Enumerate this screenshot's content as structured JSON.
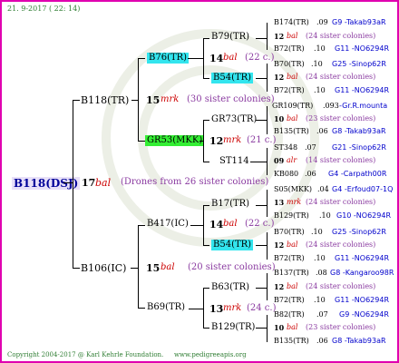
{
  "header": {
    "date": "21. 9-2017 ( 22: 14)"
  },
  "footer": {
    "copyright": "Copyright 2004-2017 @ Karl Kehrle Foundation.",
    "site": "www.pedigreeapis.org"
  },
  "root": {
    "id": "B118(DSJ)",
    "num": "17",
    "bal": "bal",
    "drones": "(Drones from 26 sister colonies)"
  },
  "father": {
    "id": "B118(TR)",
    "num": "15",
    "mrk": "mrk",
    "sis": "(30 sister colonies)",
    "a": {
      "id": "B76(TR)",
      "num": "14",
      "bal": "bal",
      "sis": "(22 c.)",
      "a": {
        "id": "B79(TR)"
      },
      "b": {
        "id": "B54(TR)"
      }
    },
    "b": {
      "id": "GR53(MKK)",
      "num": "12",
      "mrk": "mrk",
      "sis": "(21 c.)",
      "a": {
        "id": "GR73(TR)"
      },
      "b": {
        "id": "ST114"
      }
    }
  },
  "mother": {
    "id": "B106(IC)",
    "num": "15",
    "bal": "bal",
    "sis": "(20 sister colonies)",
    "a": {
      "id": "B417(IC)",
      "num": "14",
      "bal": "bal",
      "sis": "(22 c.)",
      "a": {
        "id": "B17(TR)"
      },
      "b": {
        "id": "B54(TR)"
      }
    },
    "b": {
      "id": "B69(TR)",
      "num": "13",
      "mrk": "mrk",
      "sis": "(24 c.)",
      "a": {
        "id": "B63(TR)"
      },
      "b": {
        "id": "B129(TR)"
      }
    }
  },
  "right": [
    {
      "id": "B174(TR)",
      "yr": ".09",
      "code": "G9 -Takab93aR"
    },
    {
      "num": "12",
      "race": "bal",
      "sis": "(24 sister colonies)"
    },
    {
      "id": "B72(TR)",
      "yr": ".10",
      "code": "G11 -NO6294R"
    },
    {
      "id": "B70(TR)",
      "yr": ".10",
      "code": "G25 -Sinop62R"
    },
    {
      "num": "12",
      "race": "bal",
      "sis": "(24 sister colonies)"
    },
    {
      "id": "B72(TR)",
      "yr": ".10",
      "code": "G11 -NO6294R"
    },
    {
      "id": "GR109(TR)",
      "yr": ".093",
      "code": "-Gr.R.mounta"
    },
    {
      "num": "10",
      "race": "bal",
      "sis": "(23 sister colonies)"
    },
    {
      "id": "B135(TR)",
      "yr": ".06",
      "code": "G8 -Takab93aR"
    },
    {
      "id": "ST348",
      "yr": ".07",
      "code": "G21 -Sinop62R"
    },
    {
      "num": "09",
      "race": "alr",
      "sis": "(14 sister colonies)"
    },
    {
      "id": "KB080",
      "yr": ".06",
      "code": "G4 -Carpath00R"
    },
    {
      "id": "S05(MKK)",
      "yr": ".04",
      "code": "G4 -Erfoud07-1Q"
    },
    {
      "num": "13",
      "race": "mrk",
      "sis": "(24 sister colonies)"
    },
    {
      "id": "B129(TR)",
      "yr": ".10",
      "code": "G10 -NO6294R"
    },
    {
      "id": "B70(TR)",
      "yr": ".10",
      "code": "G25 -Sinop62R"
    },
    {
      "num": "12",
      "race": "bal",
      "sis": "(24 sister colonies)"
    },
    {
      "id": "B72(TR)",
      "yr": ".10",
      "code": "G11 -NO6294R"
    },
    {
      "id": "B137(TR)",
      "yr": ".08",
      "code": "G8 -Kangaroo98R"
    },
    {
      "num": "12",
      "race": "bal",
      "sis": "(24 sister colonies)"
    },
    {
      "id": "B72(TR)",
      "yr": ".10",
      "code": "G11 -NO6294R"
    },
    {
      "id": "B82(TR)",
      "yr": ".07",
      "code": "G9 -NO6294R"
    },
    {
      "num": "10",
      "race": "bal",
      "sis": "(23 sister colonies)"
    },
    {
      "id": "B135(TR)",
      "yr": ".06",
      "code": "G8 -Takab93aR"
    }
  ]
}
